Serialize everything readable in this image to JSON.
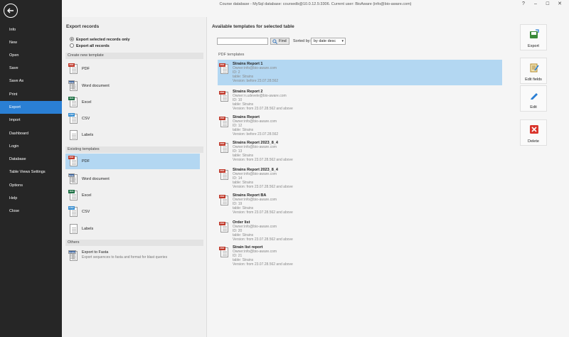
{
  "window": {
    "title": "Course database - MySql database: coursedb@10.0.12.5:3306. Current user: BioAware (info@bio-aware.com)",
    "help": "?",
    "minimize": "–",
    "maximize": "☐",
    "close": "✕"
  },
  "sidebar": {
    "items": [
      {
        "label": "Info"
      },
      {
        "label": "New"
      },
      {
        "label": "Open"
      },
      {
        "label": "Save"
      },
      {
        "label": "Save As"
      },
      {
        "label": "Print"
      },
      {
        "label": "Export"
      },
      {
        "label": "Import"
      },
      {
        "label": "Dashboard"
      },
      {
        "label": "Login"
      },
      {
        "label": "Database"
      },
      {
        "label": "Table Views Settings"
      },
      {
        "label": "Options"
      },
      {
        "label": "Help"
      },
      {
        "label": "Close"
      }
    ],
    "active_index": 6
  },
  "export_records": {
    "title": "Export records",
    "options": [
      {
        "label": "Export selected records only",
        "selected": true
      },
      {
        "label": "Export all records",
        "selected": false
      }
    ],
    "create_header": "Create new template",
    "create_items": [
      {
        "label": "PDF",
        "icon": "pdf-icon",
        "badge": "PDF"
      },
      {
        "label": "Word document",
        "icon": "word-icon",
        "badge": "DOC"
      },
      {
        "label": "Excel",
        "icon": "excel-icon",
        "badge": "XLS"
      },
      {
        "label": "CSV",
        "icon": "csv-icon",
        "badge": "CSV"
      },
      {
        "label": "Labels",
        "icon": "labels-icon",
        "badge": ""
      }
    ],
    "existing_header": "Existing templates",
    "existing_items": [
      {
        "label": "PDF",
        "icon": "pdf-icon",
        "badge": "PDF",
        "selected": true
      },
      {
        "label": "Word document",
        "icon": "word-icon",
        "badge": "DOC",
        "selected": false
      },
      {
        "label": "Excel",
        "icon": "excel-icon",
        "badge": "XLS",
        "selected": false
      },
      {
        "label": "CSV",
        "icon": "csv-icon",
        "badge": "CSV",
        "selected": false
      },
      {
        "label": "Labels",
        "icon": "labels-icon",
        "badge": "",
        "selected": false
      }
    ],
    "others_header": "Others",
    "fasta": {
      "label": "Export to Fasta",
      "description": "Export sequences to fasta and format for blast queries",
      "badge": "FASTA"
    }
  },
  "templates": {
    "title": "Available templates for selected table",
    "search": {
      "value": "",
      "placeholder": ""
    },
    "find_label": "Find",
    "sorted_by_label": "Sorted by:",
    "sort_value": "by date desc",
    "group_header": "PDF templates",
    "reports": [
      {
        "name": "Strains Report 1",
        "owner": "Owner:info@bio-aware.com",
        "id": "ID: 2",
        "table": "table: Strains",
        "version": "Version: before 23.07.28.562",
        "selected": true
      },
      {
        "name": "Strains Report 2",
        "owner": "Owner:n.udevele@bio-aware.com",
        "id": "ID: 10",
        "table": "table: Strains",
        "version": "Version: from 23.07.28.562 and above",
        "selected": false
      },
      {
        "name": "Strains Report",
        "owner": "Owner:info@bio-aware.com",
        "id": "ID: 12",
        "table": "table: Strains",
        "version": "Version: before 23.07.28.562",
        "selected": false
      },
      {
        "name": "Strains Report 2023_8_4",
        "owner": "Owner:info@bio-aware.com",
        "id": "ID: 13",
        "table": "table: Strains",
        "version": "Version: from 23.07.28.562 and above",
        "selected": false
      },
      {
        "name": "Strains Report 2023_8_4",
        "owner": "Owner:info@bio-aware.com",
        "id": "ID: 14",
        "table": "table: Strains",
        "version": "Version: from 23.07.28.562 and above",
        "selected": false
      },
      {
        "name": "Strains Report BA",
        "owner": "Owner:info@bio-aware.com",
        "id": "ID: 19",
        "table": "table: Strains",
        "version": "Version: from 23.07.28.562 and above",
        "selected": false
      },
      {
        "name": "Order list",
        "owner": "Owner:info@bio-aware.com",
        "id": "ID: 20",
        "table": "table: Strains",
        "version": "Version: from 23.07.28.562 and above",
        "selected": false
      },
      {
        "name": "Strain list report",
        "owner": "Owner:info@bio-aware.com",
        "id": "ID: 21",
        "table": "table: Strains",
        "version": "Version: from 23.07.28.562 and above",
        "selected": false
      }
    ]
  },
  "actions": [
    {
      "label": "Export",
      "icon": "export-icon"
    },
    {
      "label": "Edit fields",
      "icon": "edit-fields-icon"
    },
    {
      "label": "Edit",
      "icon": "pencil-icon"
    },
    {
      "label": "Delete",
      "icon": "delete-icon"
    }
  ],
  "colors": {
    "sidebar_bg": "#262626",
    "active_nav": "#2a7fd4",
    "selection": "#b3d7f2"
  }
}
